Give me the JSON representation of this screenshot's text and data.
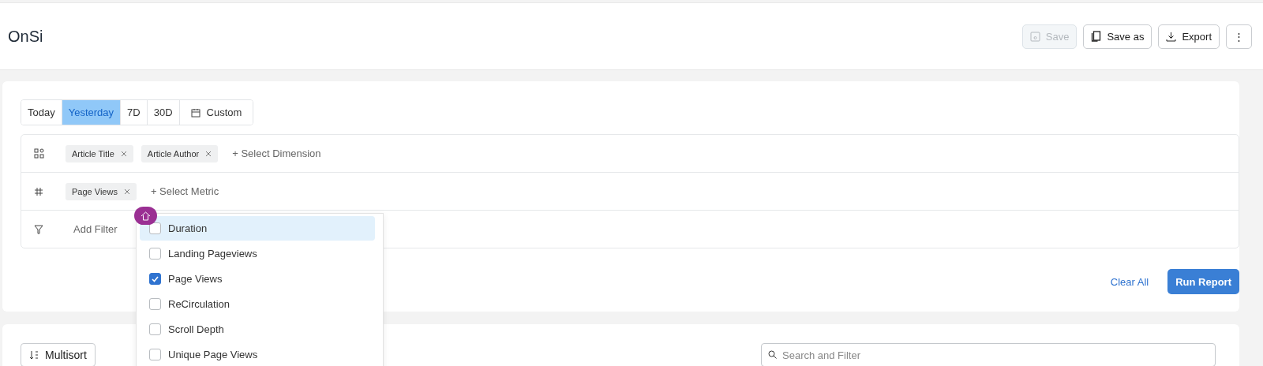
{
  "header": {
    "title": "OnSi",
    "actions": [
      {
        "kind": "save",
        "label": "Save",
        "disabled": true
      },
      {
        "kind": "saveas",
        "label": "Save as",
        "disabled": false
      },
      {
        "kind": "export",
        "label": "Export",
        "disabled": false
      },
      {
        "kind": "more",
        "label": "⋮",
        "disabled": false
      }
    ]
  },
  "date_tabs": [
    {
      "label": "Today",
      "selected": false,
      "kind": "text"
    },
    {
      "label": "Yesterday",
      "selected": true,
      "kind": "text"
    },
    {
      "label": "7D",
      "selected": false,
      "kind": "text"
    },
    {
      "label": "30D",
      "selected": false,
      "kind": "text"
    },
    {
      "label": "Custom",
      "selected": false,
      "kind": "calendar"
    }
  ],
  "query_rows": [
    {
      "kind": "dimension",
      "chips": [
        "Article Title",
        "Article Author"
      ],
      "add": "+ Select Dimension"
    },
    {
      "kind": "metric",
      "chips": [
        "Page Views"
      ],
      "add": "+ Select Metric"
    },
    {
      "kind": "filter",
      "chips": [],
      "add": "Add Filter"
    }
  ],
  "metric_menu": {
    "items": [
      {
        "label": "Duration",
        "checked": false,
        "selected": true
      },
      {
        "label": "Landing Pageviews",
        "checked": false,
        "selected": false
      },
      {
        "label": "Page Views",
        "checked": true,
        "selected": false
      },
      {
        "label": "ReCirculation",
        "checked": false,
        "selected": false
      },
      {
        "label": "Scroll Depth",
        "checked": false,
        "selected": false
      },
      {
        "label": "Unique Page Views",
        "checked": false,
        "selected": false
      }
    ]
  },
  "footer": {
    "clear": "Clear All",
    "run": "Run Report"
  },
  "results": {
    "sort_button": "Multisort",
    "search": {
      "placeholder": "Search and Filter"
    }
  }
}
